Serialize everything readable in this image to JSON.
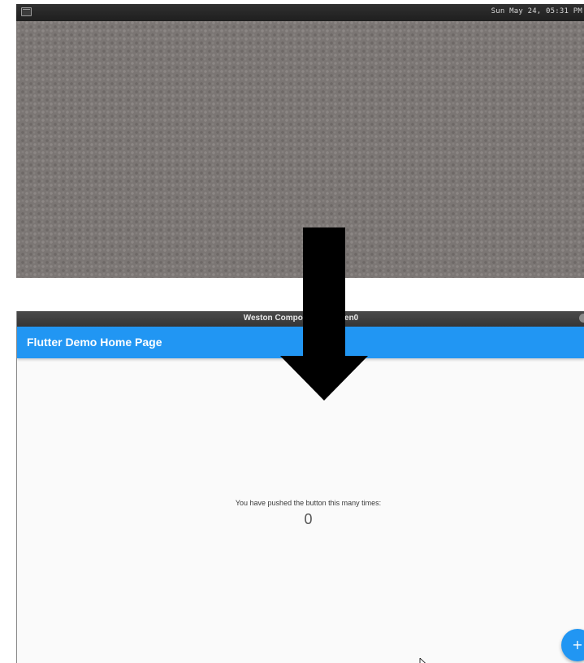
{
  "desktop": {
    "panel": {
      "launcher_icon": "terminal-icon",
      "clock": "Sun May 24, 05:31 PM"
    },
    "background_color": "#7b7674"
  },
  "window": {
    "title": "Weston Compositor - screen0",
    "close_icon": "close-icon",
    "app": {
      "appbar_title": "Flutter Demo Home Page",
      "appbar_color": "#2196f3",
      "caption": "You have pushed the button this many times:",
      "counter": "0",
      "fab_icon": "plus-icon",
      "fab_label": "+"
    }
  },
  "overlay": {
    "arrow_icon": "down-arrow-icon",
    "arrow_color": "#000000"
  }
}
